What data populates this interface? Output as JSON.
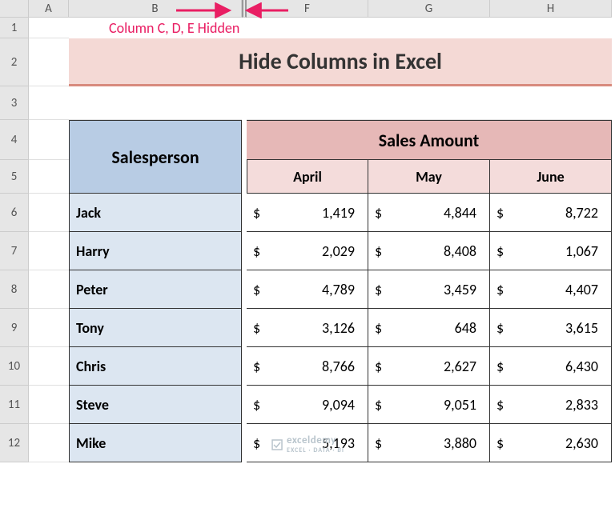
{
  "columnHeaders": [
    "A",
    "B",
    "F",
    "G",
    "H"
  ],
  "rowHeaders": [
    "1",
    "2",
    "3",
    "4",
    "5",
    "6",
    "7",
    "8",
    "9",
    "10",
    "11",
    "12"
  ],
  "annotation": "Column C, D, E Hidden",
  "title": "Hide Columns in Excel",
  "tableHeaders": {
    "salesperson": "Salesperson",
    "salesAmount": "Sales Amount",
    "months": [
      "April",
      "May",
      "June"
    ]
  },
  "currency": "$",
  "rows": [
    {
      "name": "Jack",
      "vals": [
        "1,419",
        "4,844",
        "8,722"
      ]
    },
    {
      "name": "Harry",
      "vals": [
        "2,029",
        "8,408",
        "1,067"
      ]
    },
    {
      "name": "Peter",
      "vals": [
        "4,789",
        "3,459",
        "4,407"
      ]
    },
    {
      "name": "Tony",
      "vals": [
        "3,126",
        "648",
        "3,615"
      ]
    },
    {
      "name": "Chris",
      "vals": [
        "8,766",
        "2,627",
        "6,430"
      ]
    },
    {
      "name": "Steve",
      "vals": [
        "9,094",
        "9,051",
        "2,833"
      ]
    },
    {
      "name": "Mike",
      "vals": [
        "5,193",
        "3,880",
        "2,630"
      ]
    }
  ],
  "watermark": {
    "brand": "exceldemy",
    "sub": "EXCEL · DATA · BI"
  },
  "chart_data": {
    "type": "table",
    "title": "Hide Columns in Excel",
    "note": "Columns C, D, E are hidden",
    "columns": [
      "Salesperson",
      "April",
      "May",
      "June"
    ],
    "rows": [
      [
        "Jack",
        1419,
        4844,
        8722
      ],
      [
        "Harry",
        2029,
        8408,
        1067
      ],
      [
        "Peter",
        4789,
        3459,
        4407
      ],
      [
        "Tony",
        3126,
        648,
        3615
      ],
      [
        "Chris",
        8766,
        2627,
        6430
      ],
      [
        "Steve",
        9094,
        9051,
        2833
      ],
      [
        "Mike",
        5193,
        3880,
        2630
      ]
    ]
  }
}
